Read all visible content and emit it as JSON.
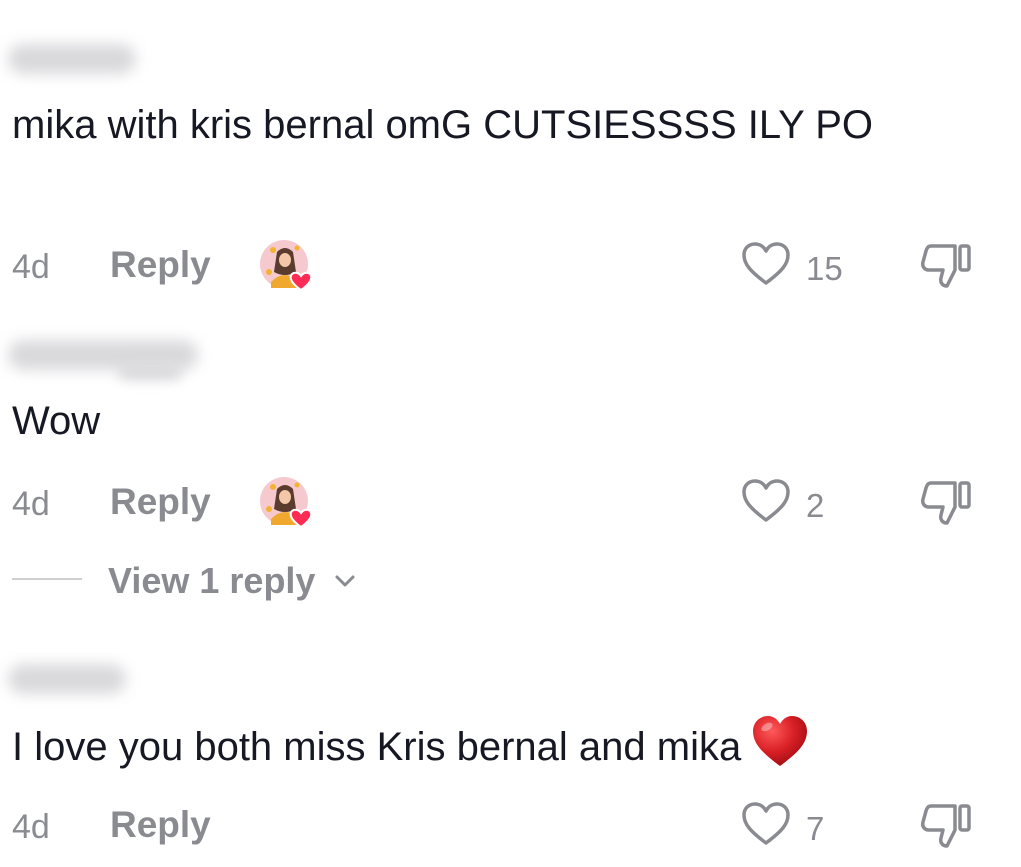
{
  "comments": [
    {
      "text": "mika with kris bernal omG CUTSIESSSS ILY PO",
      "age": "4d",
      "reply_label": "Reply",
      "likes": "15",
      "creator_liked": true
    },
    {
      "text": "Wow",
      "age": "4d",
      "reply_label": "Reply",
      "likes": "2",
      "creator_liked": true,
      "view_replies_label": "View 1 reply"
    },
    {
      "text": "I love you both miss Kris bernal and mika",
      "text_emoji": "red-heart-emoji",
      "age": "4d",
      "reply_label": "Reply",
      "likes": "7",
      "creator_liked": false
    }
  ],
  "colors": {
    "text_primary": "#161823",
    "text_secondary": "#8a8b91",
    "heart_red": "#fe2c55",
    "emoji_red": "#c8102e"
  },
  "icons": {
    "like": "heart-outline-icon",
    "dislike": "thumbs-down-icon",
    "expand": "chevron-down-icon",
    "creator_badge": "creator-liked-avatar"
  }
}
